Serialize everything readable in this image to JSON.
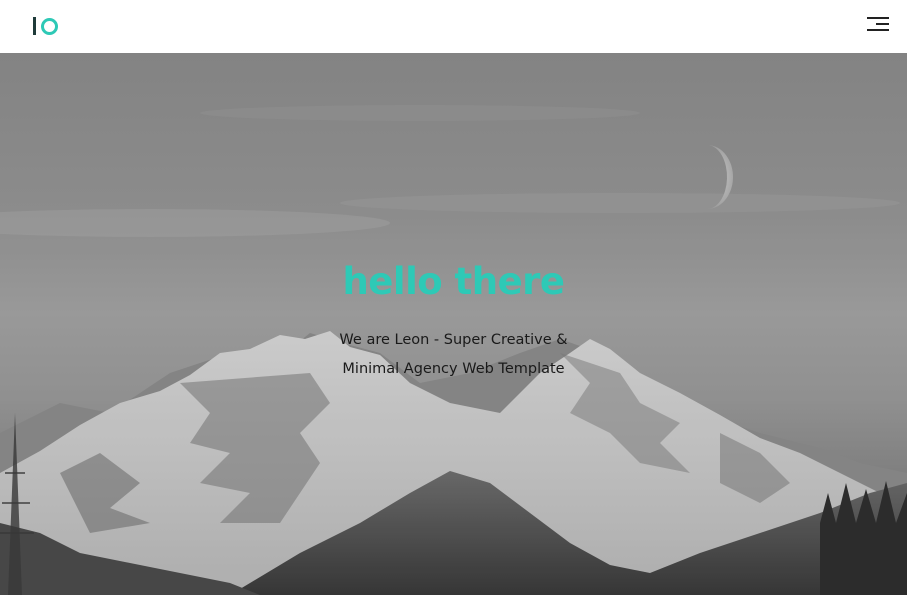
{
  "header": {
    "logo_name": "io-logo",
    "menu_icon": "hamburger-menu-icon"
  },
  "hero": {
    "background_image": "snowy-mountain-moon-photo",
    "title": "hello there",
    "line1": "We are Leon - Super Creative &",
    "line2": "Minimal Agency Web Template"
  },
  "colors": {
    "accent": "#2ec9b6",
    "text_dark": "#1a1a1a",
    "header_bg": "#ffffff"
  }
}
